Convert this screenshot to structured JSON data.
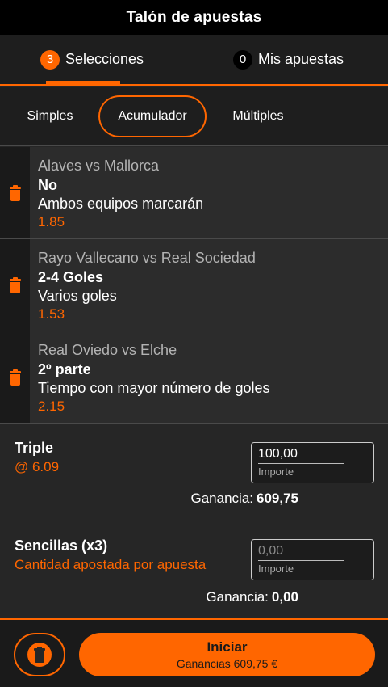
{
  "header": {
    "title": "Talón de apuestas"
  },
  "top_tabs": [
    {
      "count": "3",
      "label": "Selecciones",
      "active": true
    },
    {
      "count": "0",
      "label": "Mis apuestas",
      "active": false
    }
  ],
  "sub_tabs": [
    {
      "label": "Simples",
      "active": false
    },
    {
      "label": "Acumulador",
      "active": true
    },
    {
      "label": "Múltiples",
      "active": false
    }
  ],
  "selections": [
    {
      "match": "Alaves vs Mallorca",
      "pick": "No",
      "market": "Ambos equipos marcarán",
      "odds": "1.85"
    },
    {
      "match": "Rayo Vallecano vs Real Sociedad",
      "pick": "2-4 Goles",
      "market": "Varios goles",
      "odds": "1.53"
    },
    {
      "match": "Real Oviedo vs Elche",
      "pick": "2º parte",
      "market": "Tiempo con mayor número de goles",
      "odds": "2.15"
    }
  ],
  "triple": {
    "title": "Triple",
    "odds": "@ 6.09",
    "stake_value": "100,00",
    "stake_placeholder": "Importe",
    "gain_label": "Ganancia:",
    "gain_value": "609,75"
  },
  "singles": {
    "title": "Sencillas (x3)",
    "subtitle": "Cantidad apostada por apuesta",
    "stake_value": "0,00",
    "stake_placeholder": "Importe",
    "gain_label": "Ganancia:",
    "gain_value": "0,00"
  },
  "footer": {
    "place_label": "Iniciar",
    "place_sub": "Ganancias 609,75 €"
  },
  "colors": {
    "accent": "#ff6600",
    "background": "#262626",
    "header": "#000000"
  }
}
